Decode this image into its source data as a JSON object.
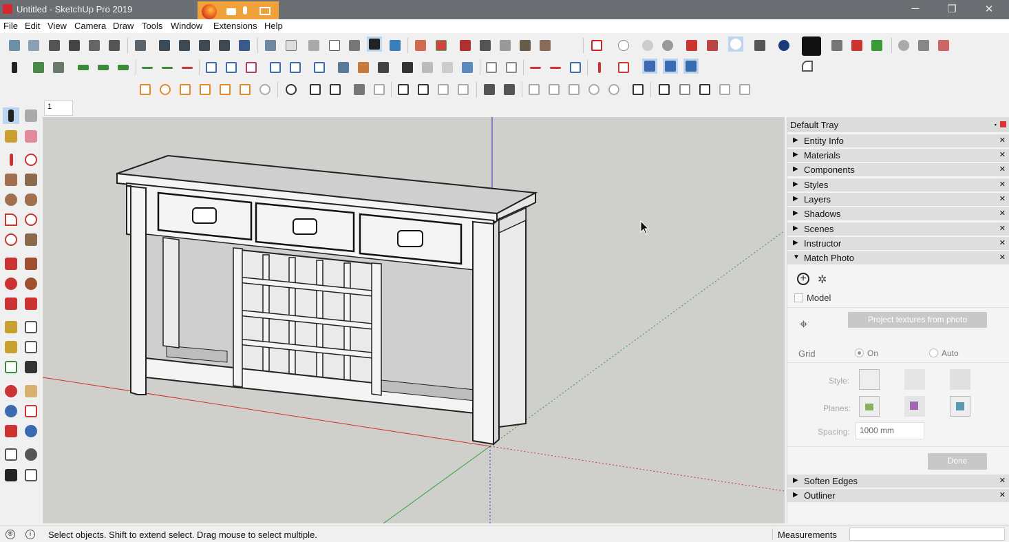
{
  "window": {
    "title": "Untitled - SketchUp Pro 2019",
    "minimize": "─",
    "maximize": "❐",
    "close": "✕"
  },
  "menu": [
    "File",
    "Edit",
    "View",
    "Camera",
    "Draw",
    "Tools",
    "Window",
    "Extensions",
    "Help"
  ],
  "scene_tab": "1",
  "tray": {
    "title": "Default Tray",
    "panels": [
      "Entity Info",
      "Materials",
      "Components",
      "Styles",
      "Layers",
      "Shadows",
      "Scenes",
      "Instructor",
      "Match Photo"
    ],
    "panels_bottom": [
      "Soften Edges",
      "Outliner"
    ],
    "match_photo": {
      "model_label": "Model",
      "project_button": "Project textures from photo",
      "grid_label": "Grid",
      "grid_on": "On",
      "grid_auto": "Auto",
      "style_label": "Style:",
      "planes_label": "Planes:",
      "spacing_label": "Spacing:",
      "spacing_value": "1000 mm",
      "done_button": "Done"
    }
  },
  "status": {
    "hint": "Select objects. Shift to extend select. Drag mouse to select multiple.",
    "measurements_label": "Measurements"
  },
  "colors": {
    "axis_red": "#d03030",
    "axis_green": "#2fa03a",
    "axis_blue": "#3030c0",
    "sky": "#cfcfcb",
    "model_face": "#f4f4f4"
  },
  "icons": [
    "select-icon",
    "paint-bucket-icon",
    "eraser-icon",
    "pencil-icon",
    "freehand-icon",
    "rectangle-icon",
    "circle-icon",
    "arc-icon",
    "move-icon",
    "push-pull-icon",
    "rotate-icon",
    "follow-me-icon",
    "scale-icon",
    "offset-icon",
    "tape-measure-icon",
    "dimension-icon",
    "protractor-icon",
    "text-icon",
    "axes-icon",
    "3d-text-icon",
    "orbit-icon",
    "pan-icon",
    "zoom-icon",
    "zoom-window-icon",
    "zoom-extents-icon",
    "position-camera-icon",
    "look-around-icon",
    "walk-icon",
    "section-plane-icon"
  ]
}
